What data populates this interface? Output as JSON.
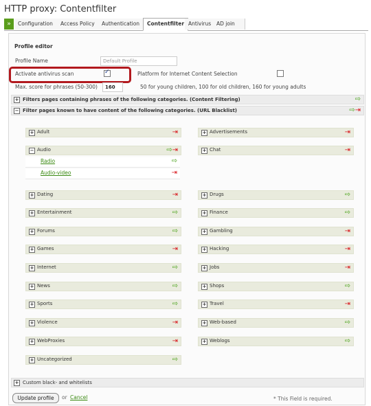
{
  "page_title": "HTTP proxy: Contentfilter",
  "tabs": [
    "Configuration",
    "Access Policy",
    "Authentication",
    "Contentfilter",
    "Antivirus",
    "AD join"
  ],
  "tab_arrow": "»",
  "profile_editor": {
    "heading": "Profile editor",
    "profile_name_label": "Profile Name",
    "profile_name_placeholder": "Default Profile",
    "antivirus_label": "Activate antivirus scan",
    "pics_label": "Platform for Internet Content Selection",
    "max_score_label": "Max. score for phrases (50-300)",
    "max_score_value": "160",
    "max_score_hint": "50 for young children, 100 for old children, 160 for young adults"
  },
  "sections": {
    "phrases": "Filters pages containing phrases of the following categories. (Content Filtering)",
    "blacklist": "Filter pages known to have content of the following categories. (URL Blacklist)",
    "custom": "Custom black- and whitelists"
  },
  "categories": {
    "adult": "Adult",
    "advertisements": "Advertisements",
    "audio": "Audio",
    "chat": "Chat",
    "radio": "Radio",
    "audio_video": "Audio-video",
    "dating": "Dating",
    "drugs": "Drugs",
    "entertainment": "Entertainment",
    "finance": "Finance",
    "forums": "Forums",
    "gambling": "Gambling",
    "games": "Games",
    "hacking": "Hacking",
    "internet": "Internet",
    "jobs": "Jobs",
    "news": "News",
    "shops": "Shops",
    "sports": "Sports",
    "travel": "Travel",
    "violence": "Violence",
    "web_based": "Web-based",
    "webproxies": "WebProxies",
    "weblogs": "Weblogs",
    "uncategorized": "Uncategorized"
  },
  "footer": {
    "update_button": "Update profile",
    "or_text": "or",
    "cancel_link": "Cancel",
    "required_note": "* This Field is required."
  },
  "colors": {
    "allow": "#4aa31b",
    "block": "#d8191e",
    "tab_accent": "#5a9d1c",
    "highlight": "#b2191e"
  }
}
